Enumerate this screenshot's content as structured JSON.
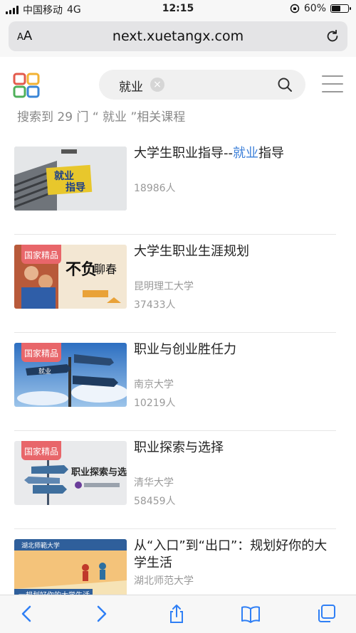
{
  "status_bar": {
    "carrier": "中国移动",
    "network": "4G",
    "time": "12:15",
    "battery": "60%",
    "battery_level": 0.6
  },
  "browser": {
    "text_size_label": "AA",
    "url": "next.xuetangx.com"
  },
  "search": {
    "query": "就业",
    "summary": "搜索到 29 门 “ 就业 ”相关课程"
  },
  "results": [
    {
      "title": "大学生职业指导--",
      "title_highlight": "就业",
      "title_tail": "指导",
      "school": "",
      "students": "18986人",
      "badge": ""
    },
    {
      "title": "大学生职业生涯规划",
      "school": "昆明理工大学",
      "students": "37433人",
      "badge": "国家精品"
    },
    {
      "title": "职业与创业胜任力",
      "school": "南京大学",
      "students": "10219人",
      "badge": "国家精品"
    },
    {
      "title": "职业探索与选择",
      "school": "清华大学",
      "students": "58459人",
      "badge": "国家精品"
    },
    {
      "title": "从“入口”到“出口”：规划好你的大学生活",
      "school": "湖北师范大学",
      "students": "",
      "badge": ""
    }
  ],
  "thumb_text": {
    "t1_sign": "就业 指导",
    "t2_big": "不负聊春",
    "t4_caption": "职业探索与选择",
    "t5_caption": "一规划好你的大学生活"
  },
  "colors": {
    "accent": "#3d80d9",
    "badge": "#e8666a",
    "ios_blue": "#2f7ff5"
  }
}
